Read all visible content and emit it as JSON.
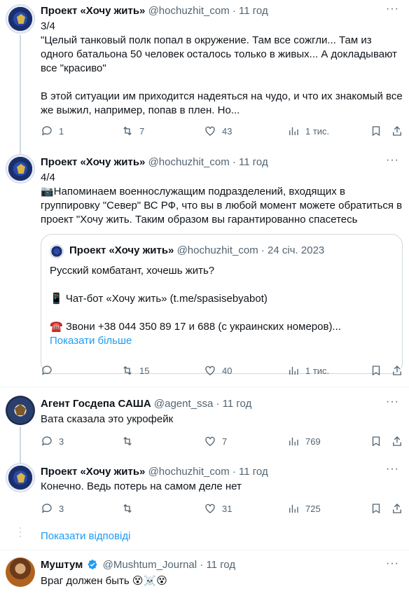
{
  "tweets": [
    {
      "author": "Проект «Хочу жить»",
      "handle": "@hochuzhit_com",
      "time": "11 год",
      "text": "3/4\n\"Целый танковый полк попал в окружение. Там все сожгли... Там из одного батальона 50 человек осталось только в живых... А докладывают все \"красиво\"\n\nВ этой ситуации им приходится надеяться на чудо, и что их знакомый все же выжил, например, попав в плен. Но...",
      "replies": "1",
      "retweets": "7",
      "likes": "43",
      "views": "1 тис."
    },
    {
      "author": "Проект «Хочу жить»",
      "handle": "@hochuzhit_com",
      "time": "11 год",
      "text": "4/4\n📷Напоминаем военнослужащим подразделений, входящих в группировку \"Север\" ВС РФ, что вы в любой момент можете обратиться в проект \"Хочу жить. Таким образом вы гарантированно спасетесь",
      "replies": "",
      "retweets": "15",
      "likes": "40",
      "views": "1 тис.",
      "quote": {
        "author": "Проект «Хочу жить»",
        "handle": "@hochuzhit_com",
        "time": "24 січ. 2023",
        "line1": "Русский комбатант, хочешь жить?",
        "line2": "📱 Чат-бот «Хочу жить» (t.me/spasisebyabot)",
        "line3": "☎️ Звони +38 044 350 89 17 и 688 (с украинских номеров)...",
        "show_more": "Показати більше"
      }
    },
    {
      "author": "Агент Госдепа САША",
      "handle": "@agent_ssa",
      "time": "11 год",
      "text": "Вата сказала это укрофейк",
      "replies": "3",
      "retweets": "",
      "likes": "7",
      "views": "769"
    },
    {
      "author": "Проект «Хочу жить»",
      "handle": "@hochuzhit_com",
      "time": "11 год",
      "text": "Конечно. Ведь потерь на самом деле нет",
      "replies": "3",
      "retweets": "",
      "likes": "31",
      "views": "725"
    },
    {
      "author": "Муштум",
      "handle": "@Mushtum_Journal",
      "time": "11 год",
      "text": "Враг должен быть 😵☠️😵"
    }
  ],
  "show_replies": "Показати відповіді",
  "dot": "·",
  "more": "···",
  "colors": {
    "accent": "#1d9bf0",
    "verified": "#1d9bf0",
    "muted": "#536471"
  },
  "icons": [
    "reply-icon",
    "retweet-icon",
    "like-icon",
    "views-icon",
    "bookmark-icon",
    "share-icon",
    "verified-badge-icon",
    "more-icon"
  ]
}
